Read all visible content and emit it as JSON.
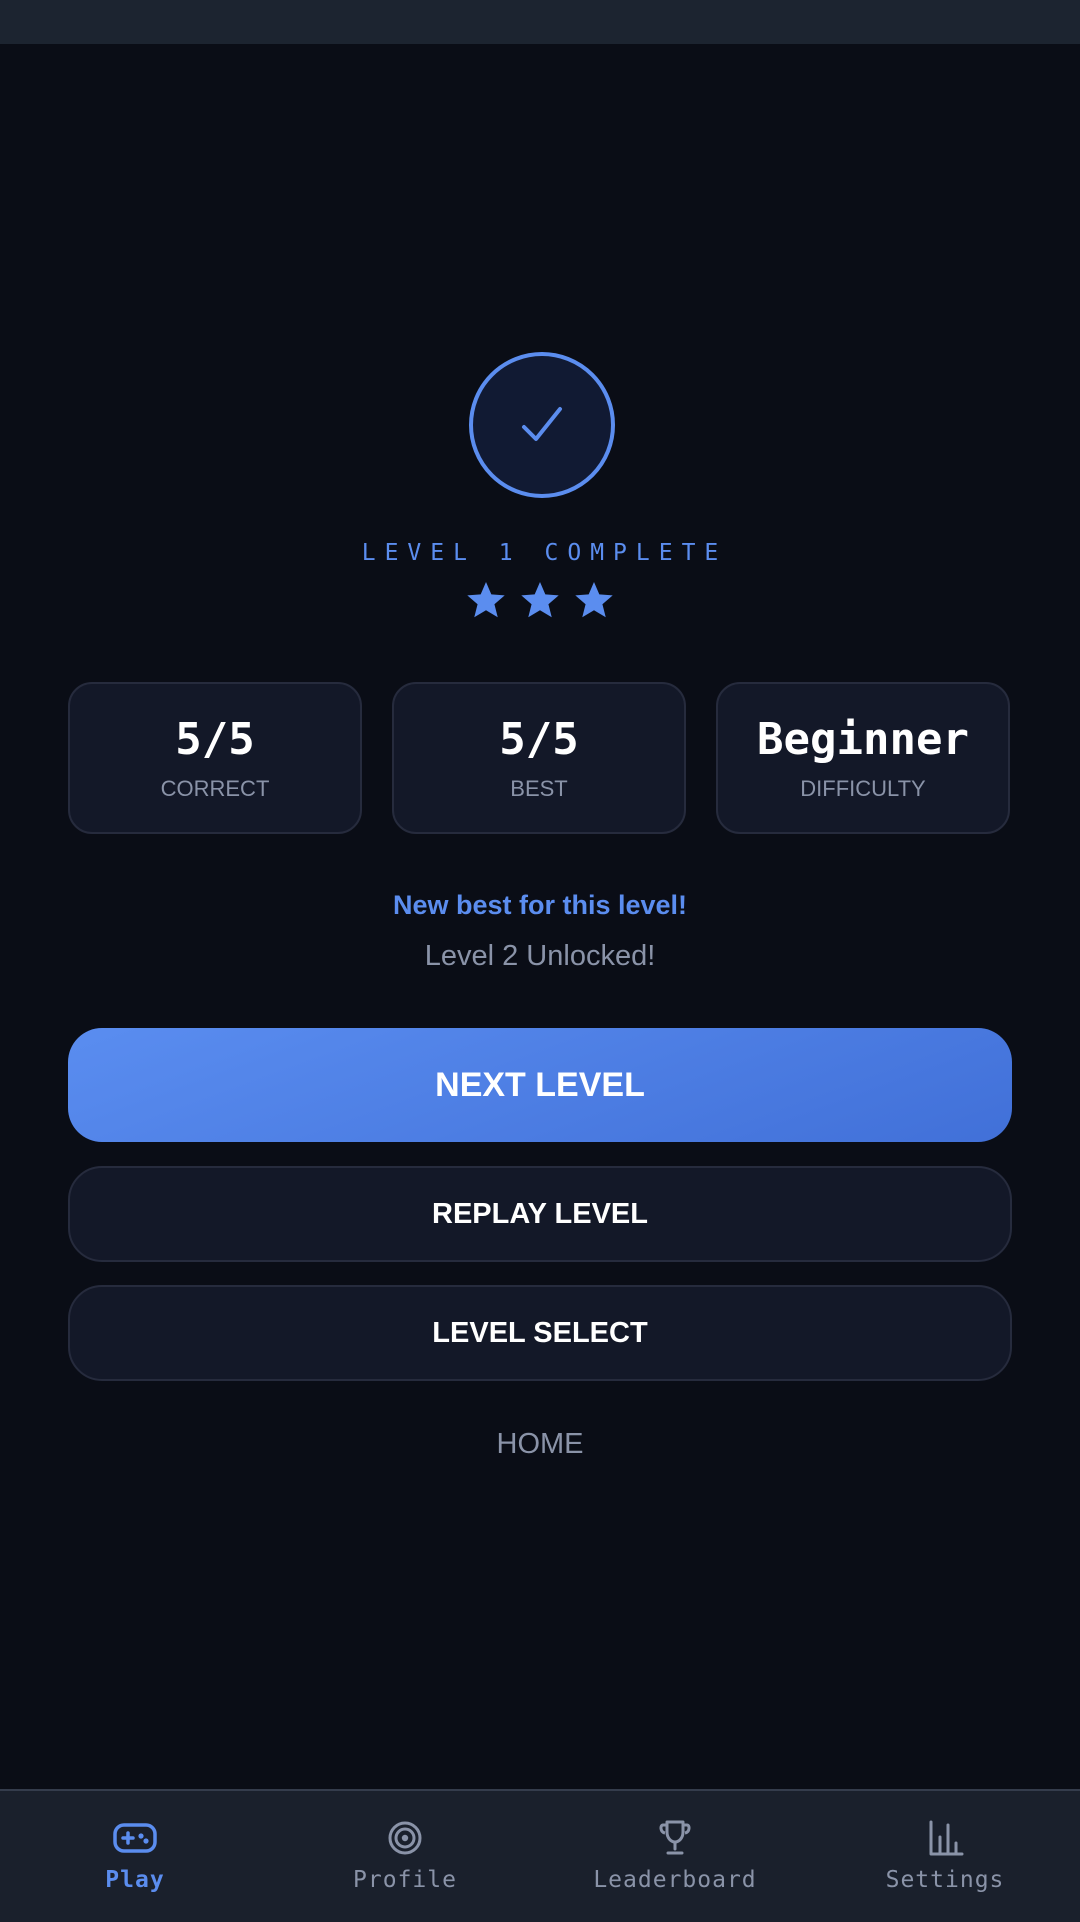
{
  "result": {
    "title": "LEVEL 1 COMPLETE",
    "stars_earned": 3,
    "stars_total": 3,
    "stats": [
      {
        "value": "5/5",
        "label": "CORRECT"
      },
      {
        "value": "5/5",
        "label": "BEST"
      },
      {
        "value": "Beginner",
        "label": "DIFFICULTY"
      }
    ],
    "best_message": "New best for this level!",
    "unlock_message": "Level 2 Unlocked!"
  },
  "actions": {
    "next_label": "NEXT LEVEL",
    "replay_label": "REPLAY LEVEL",
    "select_label": "LEVEL SELECT",
    "home_label": "HOME"
  },
  "nav": {
    "items": [
      {
        "label": "Play",
        "icon": "gamepad-icon",
        "active": true
      },
      {
        "label": "Profile",
        "icon": "target-icon",
        "active": false
      },
      {
        "label": "Leaderboard",
        "icon": "trophy-icon",
        "active": false
      },
      {
        "label": "Settings",
        "icon": "bar-chart-icon",
        "active": false
      }
    ]
  },
  "colors": {
    "accent": "#5b8def",
    "background": "#0a0d16",
    "card": "#131828",
    "muted_text": "#8a93a8",
    "nav_background": "#1a202c"
  }
}
